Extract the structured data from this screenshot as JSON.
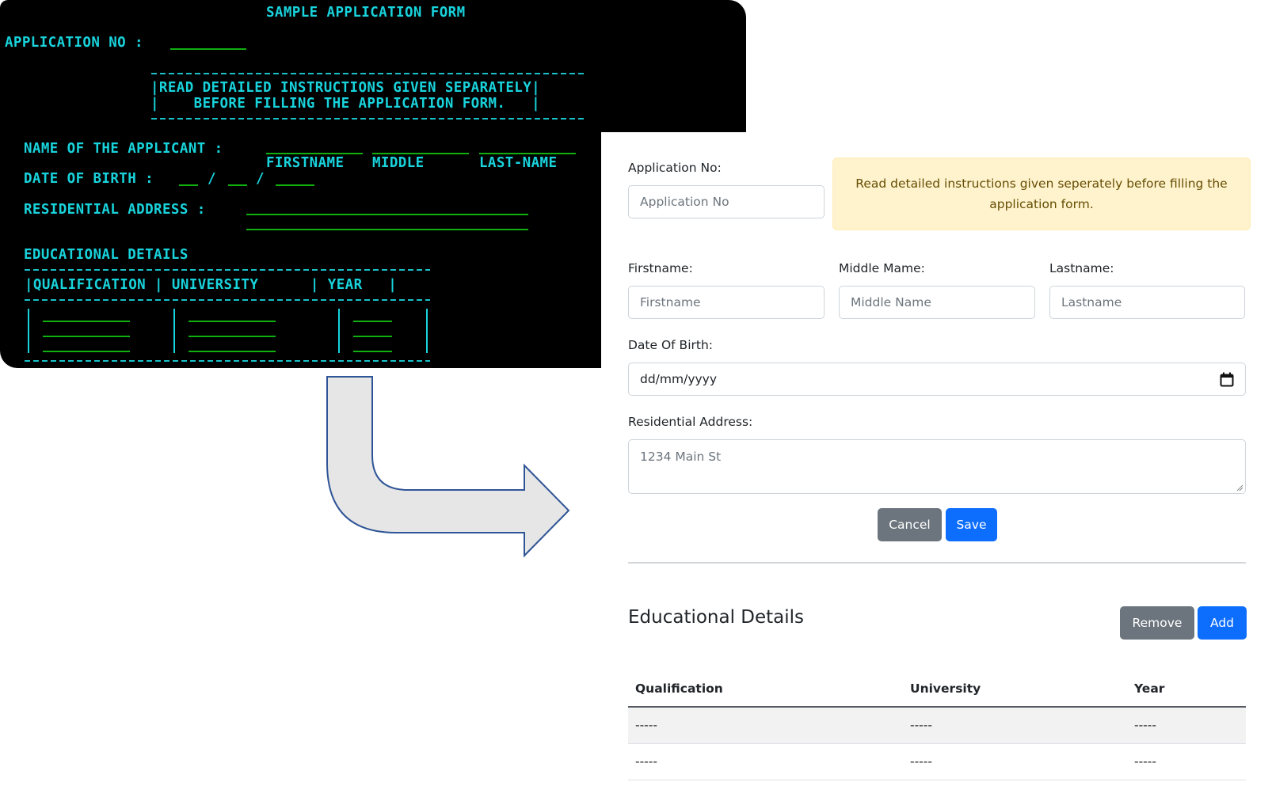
{
  "legacy_form": {
    "title": "SAMPLE APPLICATION FORM",
    "application_no_label": "APPLICATION NO :",
    "instructions_line1": "|READ DETAILED INSTRUCTIONS GIVEN SEPARATELY|",
    "instructions_line2": "|    BEFORE FILLING THE APPLICATION FORM.   |",
    "name_label": "NAME OF THE APPLICANT :",
    "name_parts": [
      "FIRSTNAME",
      "MIDDLE",
      "LAST-NAME"
    ],
    "dob_label": "DATE OF BIRTH :",
    "dob_separators": [
      "/",
      "/"
    ],
    "address_label": "RESIDENTIAL ADDRESS :",
    "education_title": "EDUCATIONAL DETAILS",
    "education_header": "|QUALIFICATION | UNIVERSITY      | YEAR   |",
    "colors": {
      "text": "#19d3dc",
      "blank_line": "#10b010",
      "background": "#000000"
    }
  },
  "arrow": {
    "icon": "curved-arrow-right-icon",
    "fill": "#e6e6e6",
    "stroke": "#2f5597"
  },
  "modern_form": {
    "application_no": {
      "label": "Application No:",
      "placeholder": "Application No",
      "value": ""
    },
    "alert": {
      "text": "Read detailed instructions given seperately before filling the application form.",
      "colors": {
        "background": "#fff3cd",
        "text": "#664d03"
      }
    },
    "firstname": {
      "label": "Firstname:",
      "placeholder": "Firstname",
      "value": ""
    },
    "middlename": {
      "label": "Middle Mame:",
      "placeholder": "Middle Name",
      "value": ""
    },
    "lastname": {
      "label": "Lastname:",
      "placeholder": "Lastname",
      "value": ""
    },
    "dob": {
      "label": "Date Of Birth:",
      "display": "dd/mm/yyyy",
      "icon": "calendar-icon"
    },
    "address": {
      "label": "Residential Address:",
      "placeholder": "1234 Main St",
      "value": ""
    },
    "buttons": {
      "cancel": "Cancel",
      "save": "Save"
    },
    "education": {
      "title": "Educational Details",
      "buttons": {
        "remove": "Remove",
        "add": "Add"
      },
      "columns": [
        "Qualification",
        "University",
        "Year"
      ],
      "rows": [
        [
          "-----",
          "-----",
          "-----"
        ],
        [
          "-----",
          "-----",
          "-----"
        ]
      ]
    },
    "colors": {
      "primary": "#0d6efd",
      "secondary": "#6c757d"
    }
  }
}
